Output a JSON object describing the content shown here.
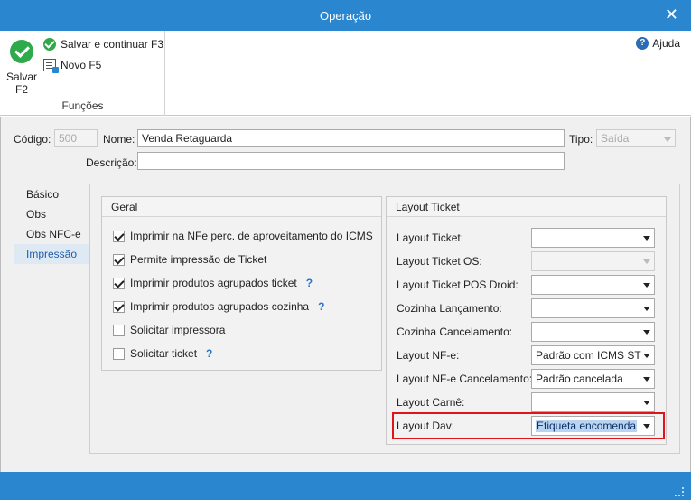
{
  "window": {
    "title": "Operação",
    "close_label": "✕"
  },
  "ribbon": {
    "save_label": "Salvar F2",
    "save_continue_label": "Salvar e continuar F3",
    "new_label": "Novo F5",
    "group_label": "Funções",
    "help_label": "Ajuda",
    "help_glyph": "?"
  },
  "form": {
    "codigo_label": "Código:",
    "codigo_value": "500",
    "nome_label": "Nome:",
    "nome_value": "Venda Retaguarda",
    "tipo_label": "Tipo:",
    "tipo_value": "Saída",
    "descricao_label": "Descrição:",
    "descricao_value": ""
  },
  "tabs": [
    {
      "label": "Básico",
      "active": false
    },
    {
      "label": "Obs",
      "active": false
    },
    {
      "label": "Obs NFC-e",
      "active": false
    },
    {
      "label": "Impressão",
      "active": true
    }
  ],
  "geral": {
    "title": "Geral",
    "items": [
      {
        "label": "Imprimir na NFe perc. de aproveitamento do ICMS",
        "checked": true,
        "help": ""
      },
      {
        "label": "Permite impressão de Ticket",
        "checked": true,
        "help": ""
      },
      {
        "label": "Imprimir produtos agrupados ticket",
        "checked": true,
        "help": "?"
      },
      {
        "label": "Imprimir produtos agrupados cozinha",
        "checked": true,
        "help": "?"
      },
      {
        "label": "Solicitar impressora",
        "checked": false,
        "help": ""
      },
      {
        "label": "Solicitar ticket",
        "checked": false,
        "help": "?"
      }
    ]
  },
  "layout_ticket": {
    "title": "Layout Ticket",
    "rows": [
      {
        "label": "Layout Ticket:",
        "value": ""
      },
      {
        "label": "Layout Ticket OS:",
        "value": ""
      },
      {
        "label": "Layout Ticket POS Droid:",
        "value": ""
      },
      {
        "label": "Cozinha Lançamento:",
        "value": ""
      },
      {
        "label": "Cozinha Cancelamento:",
        "value": ""
      },
      {
        "label": "Layout NF-e:",
        "value": "Padrão com ICMS ST"
      },
      {
        "label": "Layout NF-e Cancelamento:",
        "value": "Padrão cancelada"
      },
      {
        "label": "Layout Carnê:",
        "value": ""
      },
      {
        "label": "Layout Dav:",
        "value": "Etiqueta encomenda"
      }
    ]
  },
  "colors": {
    "titlebar": "#2a87cf",
    "highlight_border": "#e0141b",
    "save_green": "#2eaa4a"
  }
}
